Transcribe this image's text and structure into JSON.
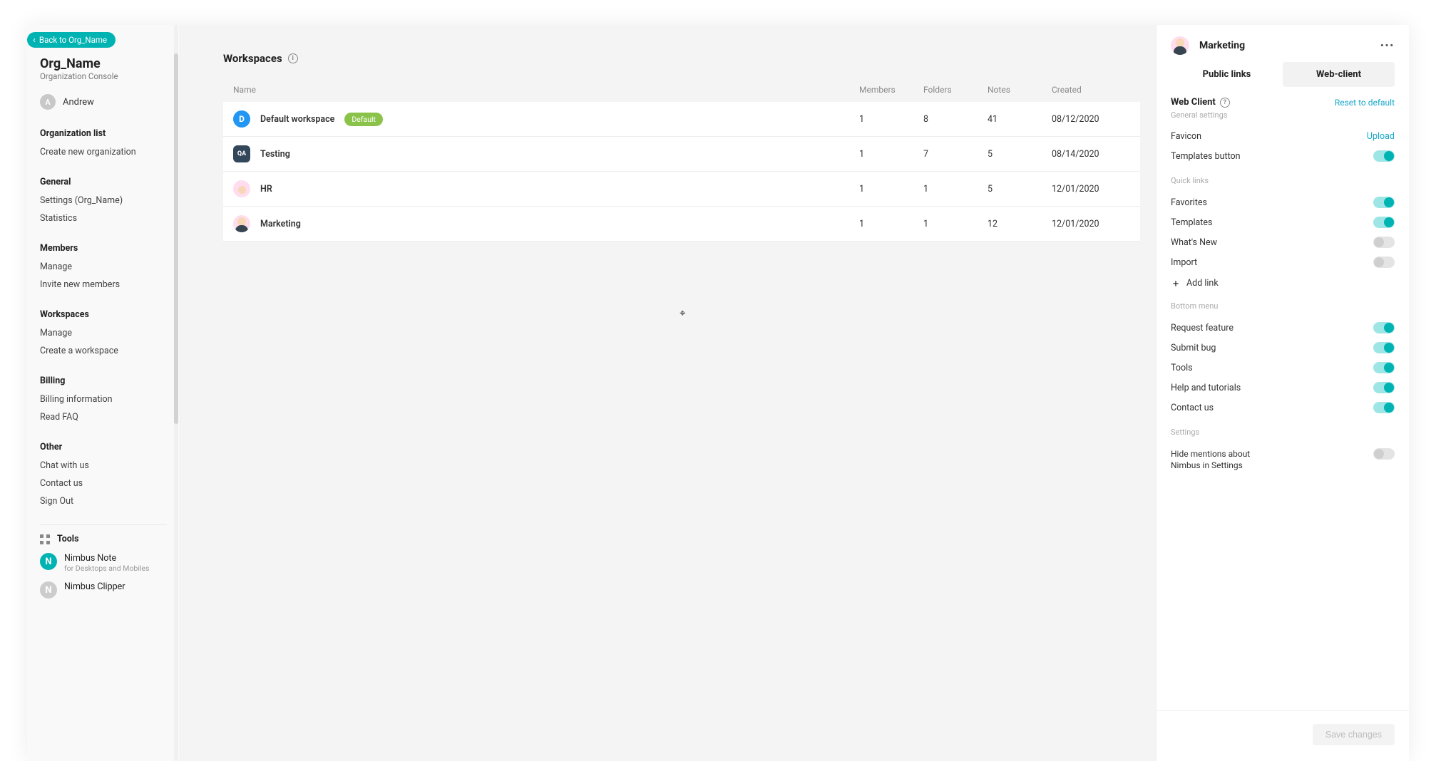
{
  "sidebar": {
    "back_label": "Back to Org_Name",
    "org_name": "Org_Name",
    "org_sub": "Organization Console",
    "user_initial": "A",
    "user_name": "Andrew",
    "groups": {
      "org_list_head": "Organization list",
      "create_org": "Create new organization",
      "general_head": "General",
      "settings": "Settings (Org_Name)",
      "statistics": "Statistics",
      "members_head": "Members",
      "manage_members": "Manage",
      "invite": "Invite new members",
      "workspaces_head": "Workspaces",
      "manage_ws": "Manage",
      "create_ws": "Create a workspace",
      "billing_head": "Billing",
      "billing_info": "Billing information",
      "read_faq": "Read FAQ",
      "other_head": "Other",
      "chat": "Chat with us",
      "contact": "Contact us",
      "signout": "Sign Out"
    },
    "tools_head": "Tools",
    "tools": [
      {
        "badge": "N",
        "name": "Nimbus Note",
        "sub": "for Desktops and Mobiles"
      },
      {
        "badge": "N",
        "name": "Nimbus Clipper",
        "sub": ""
      }
    ]
  },
  "main": {
    "title": "Workspaces",
    "columns": {
      "name": "Name",
      "members": "Members",
      "folders": "Folders",
      "notes": "Notes",
      "created": "Created"
    },
    "rows": [
      {
        "avatar_class": "av-d",
        "avatar_text": "D",
        "name": "Default workspace",
        "badge": "Default",
        "members": "1",
        "folders": "8",
        "notes": "41",
        "created": "08/12/2020"
      },
      {
        "avatar_class": "av-qa",
        "avatar_text": "QA",
        "name": "Testing",
        "badge": "",
        "members": "1",
        "folders": "7",
        "notes": "5",
        "created": "08/14/2020"
      },
      {
        "avatar_class": "av-hr",
        "avatar_text": "",
        "name": "HR",
        "badge": "",
        "members": "1",
        "folders": "1",
        "notes": "5",
        "created": "12/01/2020"
      },
      {
        "avatar_class": "av-mk",
        "avatar_text": "",
        "name": "Marketing",
        "badge": "",
        "members": "1",
        "folders": "1",
        "notes": "12",
        "created": "12/01/2020"
      }
    ]
  },
  "panel": {
    "title": "Marketing",
    "tabs": {
      "public": "Public links",
      "web": "Web-client"
    },
    "wc_title": "Web Client",
    "reset": "Reset to default",
    "general_head": "General settings",
    "favicon_label": "Favicon",
    "upload": "Upload",
    "templates_btn": "Templates button",
    "quick_head": "Quick links",
    "quick": {
      "favorites": "Favorites",
      "templates": "Templates",
      "whatsnew": "What's New",
      "import": "Import"
    },
    "add_link": "Add link",
    "bottom_head": "Bottom menu",
    "bottom": {
      "request": "Request feature",
      "submit": "Submit bug",
      "tools": "Tools",
      "help": "Help and tutorials",
      "contact": "Contact us"
    },
    "settings_head": "Settings",
    "hide_mentions": "Hide mentions about Nimbus in Settings",
    "save": "Save changes"
  }
}
